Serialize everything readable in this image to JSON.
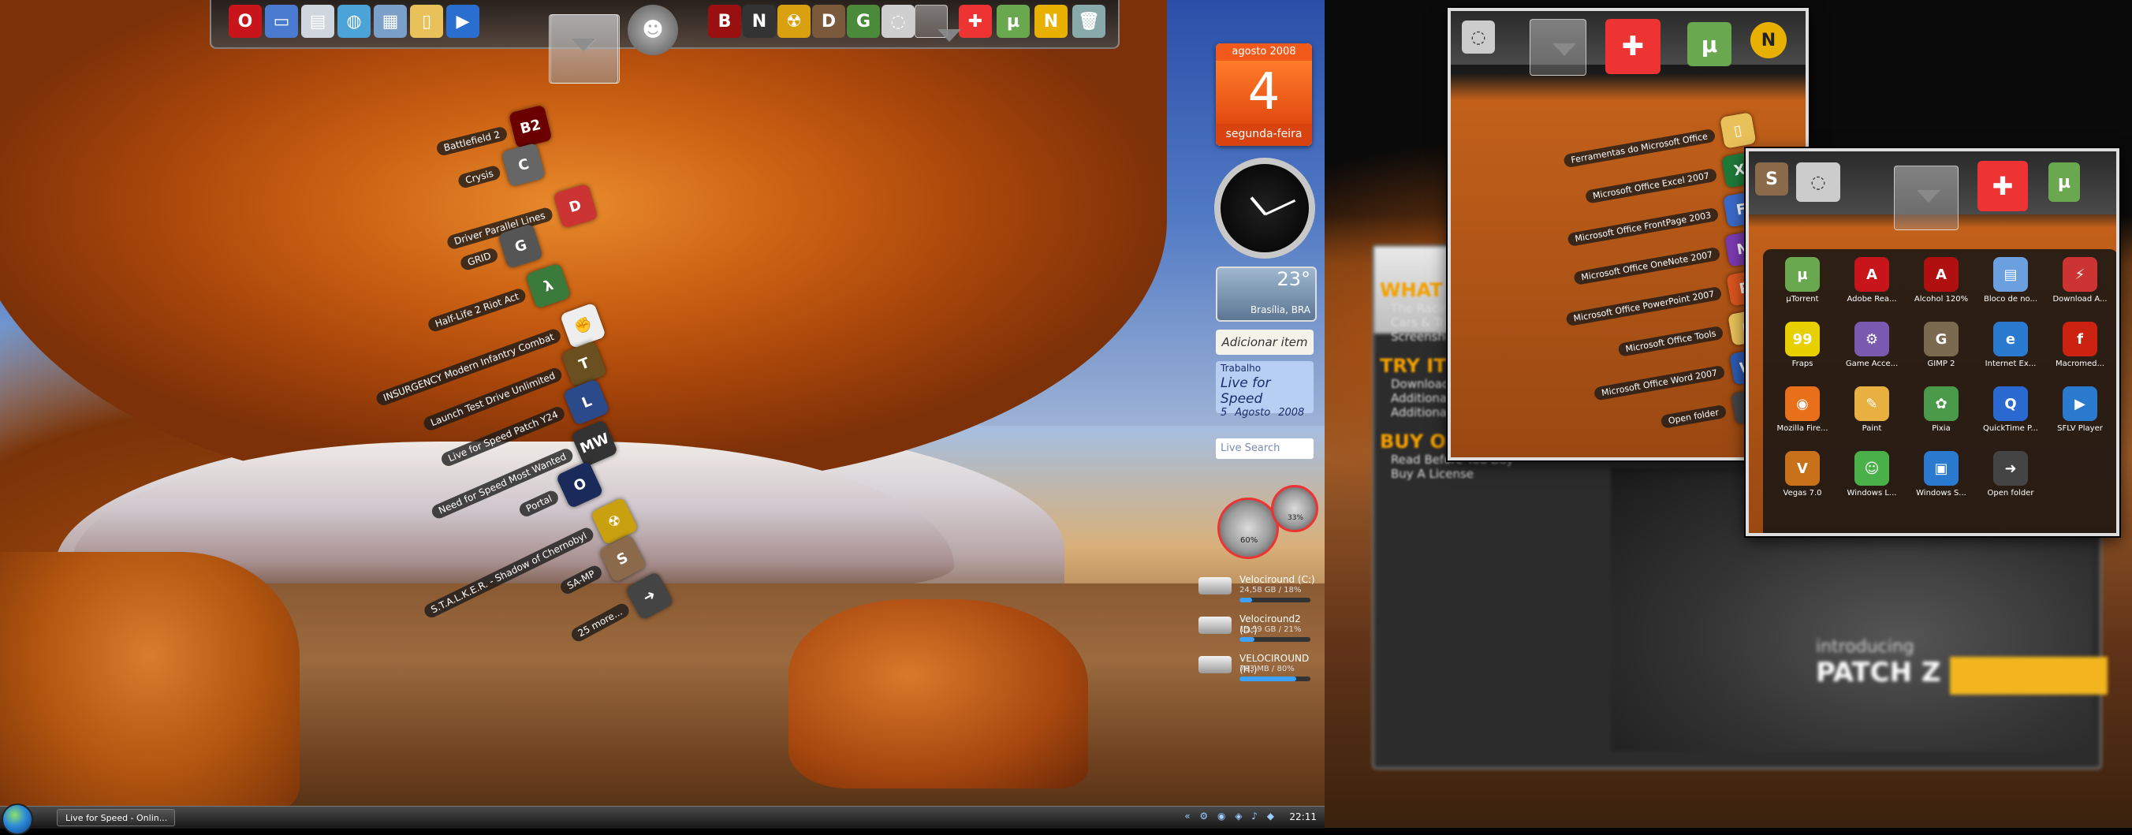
{
  "dock_left": {
    "icons": [
      {
        "name": "opera-icon",
        "glyph": "O",
        "bg": "#c8151b"
      },
      {
        "name": "computer-icon",
        "glyph": "▭",
        "bg": "#4b7bd0"
      },
      {
        "name": "documents-icon",
        "glyph": "▤",
        "bg": "#cfd6de"
      },
      {
        "name": "network-icon",
        "glyph": "◍",
        "bg": "#4ba3d8"
      },
      {
        "name": "control-panel-icon",
        "glyph": "▦",
        "bg": "#7aa0c9"
      },
      {
        "name": "folder-icon",
        "glyph": "▯",
        "bg": "#e8c15a"
      },
      {
        "name": "media-player-icon",
        "glyph": "▶",
        "bg": "#2a6fd0"
      }
    ],
    "icons_right": [
      {
        "name": "battlefield-icon",
        "glyph": "B",
        "bg": "#9a1010"
      },
      {
        "name": "nfs-icon",
        "glyph": "N",
        "bg": "#333"
      },
      {
        "name": "stalker-icon",
        "glyph": "☢",
        "bg": "#d9a010"
      },
      {
        "name": "driver-icon",
        "glyph": "D",
        "bg": "#7a5a3a"
      },
      {
        "name": "gta-icon",
        "glyph": "G",
        "bg": "#4a8a3a"
      },
      {
        "name": "chat-icon",
        "glyph": "◌",
        "bg": "#cfcfcf"
      }
    ],
    "icons_far": [
      {
        "name": "office-icon",
        "glyph": "✚",
        "bg": "#e33"
      },
      {
        "name": "utorrent-icon",
        "glyph": "µ",
        "bg": "#6aa84f"
      },
      {
        "name": "nero-icon",
        "glyph": "N",
        "bg": "#e8b000"
      },
      {
        "name": "recycle-bin-icon",
        "glyph": "🗑",
        "bg": "#8aa"
      }
    ]
  },
  "fan_stack": {
    "items": [
      {
        "label": "Battlefield 2",
        "glyph": "B2",
        "bg": "#6a0000"
      },
      {
        "label": "Crysis",
        "glyph": "C",
        "bg": "#666"
      },
      {
        "label": "Driver Parallel Lines",
        "glyph": "D",
        "bg": "#c33"
      },
      {
        "label": "GRID",
        "glyph": "G",
        "bg": "#555"
      },
      {
        "label": "Half-Life 2 Riot Act",
        "glyph": "λ",
        "bg": "#3a7a3a"
      },
      {
        "label": "INSURGENCY Modern Infantry Combat",
        "glyph": "✊",
        "bg": "#eee"
      },
      {
        "label": "Launch Test Drive Unlimited",
        "glyph": "T",
        "bg": "#6a5020"
      },
      {
        "label": "Live for Speed Patch Y24",
        "glyph": "L",
        "bg": "#2a4a8a"
      },
      {
        "label": "Need for Speed Most Wanted",
        "glyph": "MW",
        "bg": "#333"
      },
      {
        "label": "Portal",
        "glyph": "O",
        "bg": "#1a2a5a"
      },
      {
        "label": "S.T.A.L.K.E.R. - Shadow of Chernobyl",
        "glyph": "☢",
        "bg": "#c8a010"
      },
      {
        "label": "SA-MP",
        "glyph": "S",
        "bg": "#8a6a4a"
      },
      {
        "label": "25 more...",
        "glyph": "➜",
        "bg": "#444"
      }
    ]
  },
  "gadgets": {
    "calendar": {
      "month": "agosto 2008",
      "day": "4",
      "weekday": "segunda-feira"
    },
    "weather": {
      "temp": "23°",
      "city": "Brasília, BRA"
    },
    "add_item": "Adicionar item",
    "note": {
      "line1": "Trabalho",
      "line2": "Live for Speed",
      "line3": "5",
      "line4": "Agosto",
      "line5": "2008"
    },
    "search_placeholder": "Live Search",
    "meter1": "60%",
    "meter2": "33%",
    "drives": [
      {
        "name": "Velociround (C:)",
        "size": "24,58 GB / 18%",
        "fill": 0.18
      },
      {
        "name": "Velociround2 (D:)",
        "size": "15,59 GB / 21%",
        "fill": 0.21
      },
      {
        "name": "VELOCIROUND (H:)",
        "size": "783 MB / 80%",
        "fill": 0.8
      }
    ]
  },
  "taskbar": {
    "task": "Live for Speed - Onlin...",
    "time": "22:11",
    "tray": "« ⚙ ◉ ◈ ♪ ◆"
  },
  "popup_list": {
    "items": [
      {
        "label": "Ferramentas do Microsoft Office",
        "glyph": "▯",
        "bg": "#e8c15a"
      },
      {
        "label": "Microsoft Office Excel 2007",
        "glyph": "X",
        "bg": "#1f7a3a"
      },
      {
        "label": "Microsoft Office FrontPage 2003",
        "glyph": "F",
        "bg": "#3a6ac9"
      },
      {
        "label": "Microsoft Office OneNote 2007",
        "glyph": "N",
        "bg": "#7a3ab0"
      },
      {
        "label": "Microsoft Office PowerPoint 2007",
        "glyph": "P",
        "bg": "#d9541e"
      },
      {
        "label": "Microsoft Office Tools",
        "glyph": "▯",
        "bg": "#e8c15a"
      },
      {
        "label": "Microsoft Office Word 2007",
        "glyph": "W",
        "bg": "#2a5ab0"
      },
      {
        "label": "Open folder",
        "glyph": "➜",
        "bg": "#444"
      }
    ]
  },
  "popup_grid": {
    "items": [
      {
        "label": "µTorrent",
        "glyph": "µ",
        "bg": "#6aa84f"
      },
      {
        "label": "Adobe Rea...",
        "glyph": "A",
        "bg": "#c8151b"
      },
      {
        "label": "Alcohol 120%",
        "glyph": "A",
        "bg": "#b01010"
      },
      {
        "label": "Bloco de no...",
        "glyph": "▤",
        "bg": "#6aa0e0"
      },
      {
        "label": "Download A...",
        "glyph": "⚡",
        "bg": "#c33"
      },
      {
        "label": "Fraps",
        "glyph": "99",
        "bg": "#e8d000"
      },
      {
        "label": "Game Acce...",
        "glyph": "⚙",
        "bg": "#7a5ab0"
      },
      {
        "label": "GIMP 2",
        "glyph": "G",
        "bg": "#7a6a50"
      },
      {
        "label": "Internet Ex...",
        "glyph": "e",
        "bg": "#2a7ad0"
      },
      {
        "label": "Macromed...",
        "glyph": "f",
        "bg": "#c21"
      },
      {
        "label": "Mozilla Fire...",
        "glyph": "◉",
        "bg": "#e8701a"
      },
      {
        "label": "Paint",
        "glyph": "✎",
        "bg": "#e8b040"
      },
      {
        "label": "Pixia",
        "glyph": "✿",
        "bg": "#4a9a4a"
      },
      {
        "label": "QuickTime P...",
        "glyph": "Q",
        "bg": "#2a6ad0"
      },
      {
        "label": "SFLV Player",
        "glyph": "▶",
        "bg": "#2a7ad0"
      },
      {
        "label": "Vegas 7.0",
        "glyph": "V",
        "bg": "#c8701a"
      },
      {
        "label": "Windows L...",
        "glyph": "☺",
        "bg": "#4ab04a"
      },
      {
        "label": "Windows S...",
        "glyph": "▣",
        "bg": "#2a7ad0"
      },
      {
        "label": "Open folder",
        "glyph": "➜",
        "bg": "#444"
      }
    ]
  },
  "blurred_site": {
    "sections": [
      {
        "heading": "WHAT IS LFS?",
        "links": [
          "The Racing Simulator",
          "Cars & Tracks",
          "Screenshots"
        ]
      },
      {
        "heading": "TRY IT!",
        "links": [
          "Download LFS S2",
          "Additional Downloads",
          "Additional Information"
        ]
      },
      {
        "heading": "BUY ONLINE",
        "links": [
          "Read Before You Buy",
          "Buy A License"
        ]
      }
    ],
    "intro": "introducing",
    "patch": "PATCH Z"
  }
}
